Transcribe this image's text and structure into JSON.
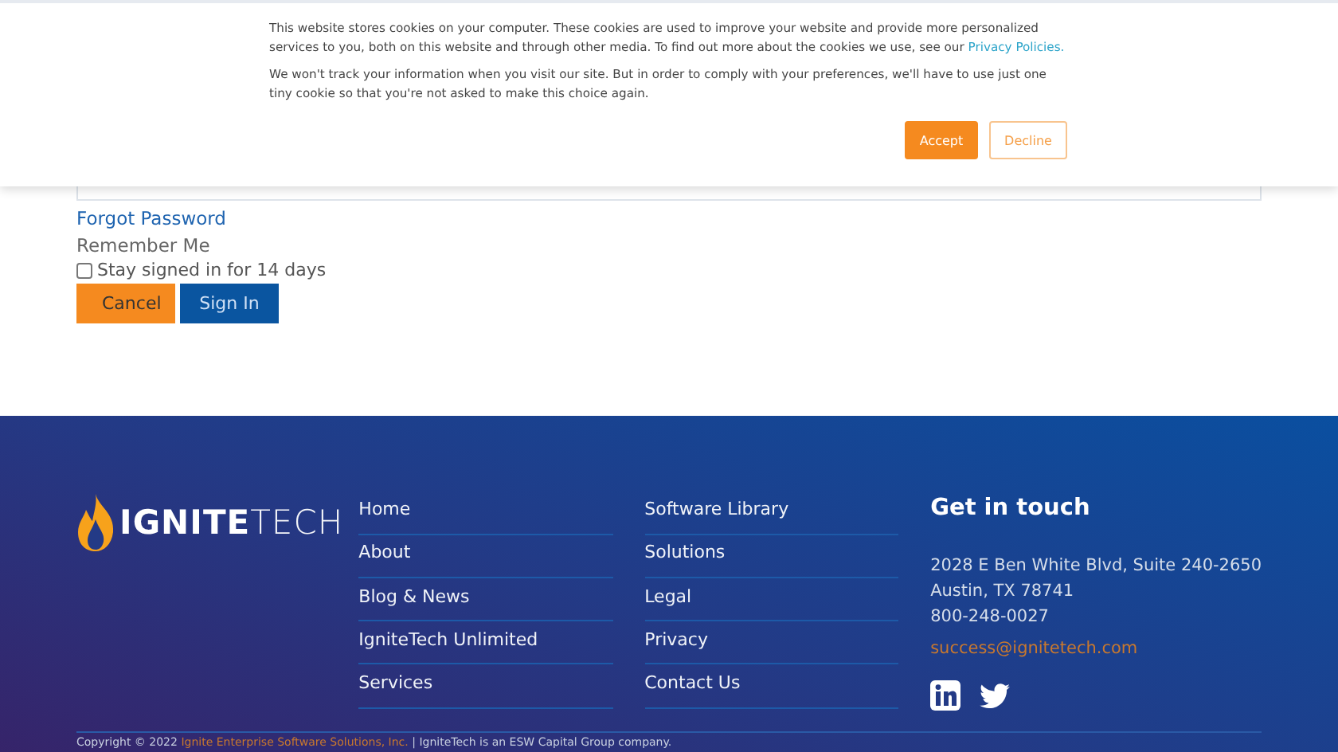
{
  "cookie_banner": {
    "paragraphs": [
      "This website stores cookies on your computer. These cookies are used to improve your website and provide more personalized services to you, both on this website and through other media. To find out more about the cookies we use, see our",
      "We won't track your information when you visit our site. But in order to comply with your preferences, we'll have to use just one tiny cookie so that you're not asked to make this choice again."
    ],
    "link": "Privacy Policies.",
    "accept": "Accept",
    "decline": "Decline"
  },
  "login": {
    "forgot_password": "Forgot Password",
    "remember_label": "Remember Me",
    "stay_signed_in": {
      "label": "Stay signed in for 14 days",
      "checked": false
    },
    "cancel": "Cancel",
    "sign_in": "Sign In"
  },
  "footer": {
    "logo": {
      "bold": "IGNITE",
      "light": "TECH"
    },
    "columns": [
      [
        "Home",
        "About",
        "Blog & News",
        "IgniteTech Unlimited",
        "Services"
      ],
      [
        "Software Library",
        "Solutions",
        "Legal",
        "Privacy",
        "Contact Us"
      ]
    ],
    "contact": {
      "heading": "Get in touch",
      "lines": [
        "2028 E Ben White Blvd, Suite 240-2650",
        "Austin, TX 78741",
        "800-248-0027"
      ],
      "email": "success@ignitetech.com"
    },
    "copyright": {
      "prefix": "Copyright © 2022",
      "company": "Ignite Enterprise Software Solutions, Inc.",
      "suffix": "| IgniteTech is an ESW Capital Group company."
    }
  }
}
